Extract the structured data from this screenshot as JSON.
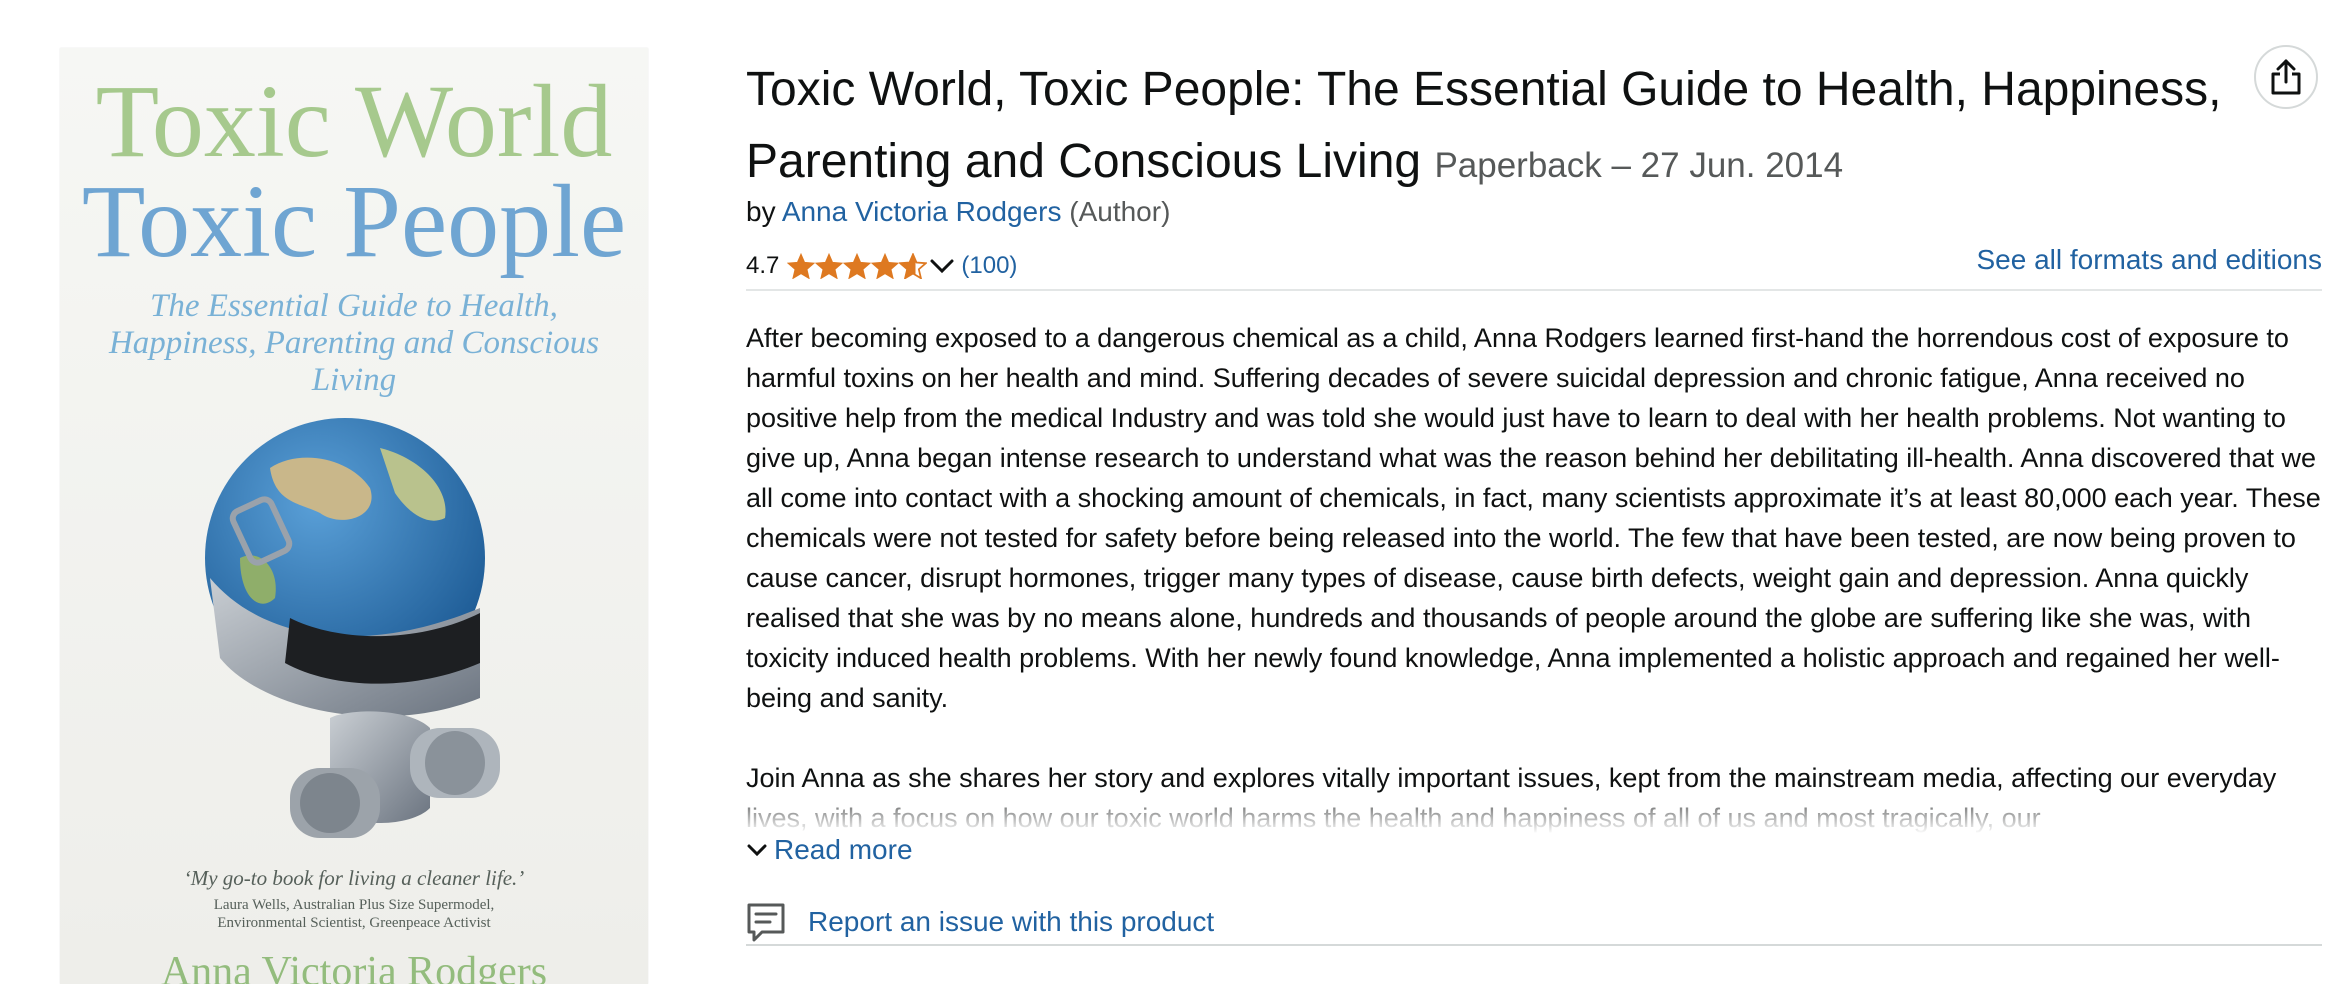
{
  "cover": {
    "title_line1": "Toxic World",
    "title_line2": "Toxic People",
    "subtitle": "The Essential Guide to Health, Happiness, Parenting and Conscious Living",
    "quote": "‘My go-to book for living a cleaner life.’",
    "endorser_line1": "Laura Wells, Australian Plus Size Supermodel,",
    "endorser_line2": "Environmental Scientist, Greenpeace Activist",
    "author": "Anna Victoria Rodgers"
  },
  "product": {
    "title": "Toxic World, Toxic People: The Essential Guide to Health, Happiness, Parenting and Conscious Living",
    "format_date": "Paperback – 27 Jun. 2014",
    "by_label": "by",
    "author": "Anna Victoria Rodgers",
    "author_role": "(Author)",
    "share_icon": "share-icon"
  },
  "rating": {
    "value": "4.7",
    "stars": 4.7,
    "star_color": "#de7921",
    "count": "(100)"
  },
  "formats_link": "See all formats and editions",
  "description": {
    "p1": "After becoming exposed to a dangerous chemical as a child, Anna Rodgers learned first-hand the horrendous cost of exposure to harmful toxins on her health and mind. Suffering decades of severe suicidal depression and chronic fatigue, Anna received no positive help from the medical Industry and was told she would just have to learn to deal with her health problems. Not wanting to give up, Anna began intense research to understand what was the reason behind her debilitating ill-health. Anna discovered that we all come into contact with a shocking amount of chemicals, in fact, many scientists approximate it’s at least 80,000 each year. These chemicals were not tested for safety before being released into the world. The few that have been tested, are now being proven to cause cancer, disrupt hormones, trigger many types of disease, cause birth defects, weight gain and depression. Anna quickly realised that she was by no means alone, hundreds and thousands of people around the globe are suffering like she was, with toxicity induced health problems. With her newly found knowledge, Anna implemented a holistic approach and regained her well-being and sanity.",
    "p2": "Join Anna as she shares her story and explores vitally important issues, kept from the mainstream media, affecting our everyday lives, with a focus on how our toxic world harms the health and happiness of all of us and most tragically, our",
    "read_more": "Read more"
  },
  "report_link": "Report an issue with this product",
  "colors": {
    "link": "#2162a1",
    "text": "#0f1111",
    "muted": "#565959",
    "star": "#de7921"
  }
}
